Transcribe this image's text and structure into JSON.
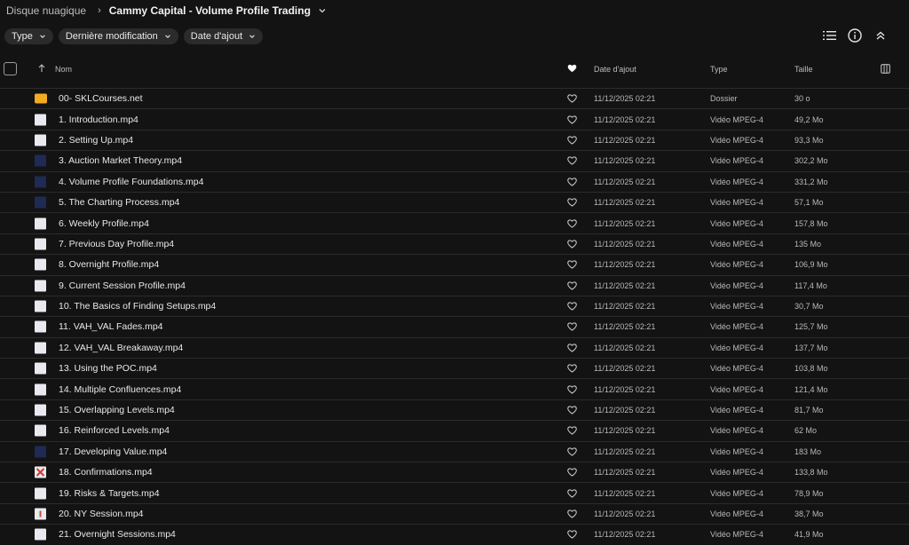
{
  "breadcrumb": {
    "root": "Disque nuagique",
    "current": "Cammy Capital - Volume Profile Trading"
  },
  "filters": [
    {
      "label": "Type"
    },
    {
      "label": "Dernière modification"
    },
    {
      "label": "Date d'ajout"
    }
  ],
  "columns": {
    "name": "Nom",
    "date_added": "Date d'ajout",
    "type": "Type",
    "size": "Taille"
  },
  "rows": [
    {
      "name": "00- SKLCourses.net",
      "date": "11/12/2025 02:21",
      "type": "Dossier",
      "size": "30 o",
      "icon": "folder-icon"
    },
    {
      "name": "1. Introduction.mp4",
      "date": "11/12/2025 02:21",
      "type": "Vidéo MPEG-4",
      "size": "49,2 Mo",
      "icon": "video-thumbnail-icon"
    },
    {
      "name": "2. Setting Up.mp4",
      "date": "11/12/2025 02:21",
      "type": "Vidéo MPEG-4",
      "size": "93,3 Mo",
      "icon": "video-thumbnail-icon"
    },
    {
      "name": "3. Auction Market Theory.mp4",
      "date": "11/12/2025 02:21",
      "type": "Vidéo MPEG-4",
      "size": "302,2 Mo",
      "icon": "video-thumbnail-icon"
    },
    {
      "name": "4. Volume Profile Foundations.mp4",
      "date": "11/12/2025 02:21",
      "type": "Vidéo MPEG-4",
      "size": "331,2 Mo",
      "icon": "video-thumbnail-icon"
    },
    {
      "name": "5. The Charting Process.mp4",
      "date": "11/12/2025 02:21",
      "type": "Vidéo MPEG-4",
      "size": "57,1 Mo",
      "icon": "video-thumbnail-icon"
    },
    {
      "name": "6. Weekly Profile.mp4",
      "date": "11/12/2025 02:21",
      "type": "Vidéo MPEG-4",
      "size": "157,8 Mo",
      "icon": "video-thumbnail-icon"
    },
    {
      "name": "7. Previous Day Profile.mp4",
      "date": "11/12/2025 02:21",
      "type": "Vidéo MPEG-4",
      "size": "135 Mo",
      "icon": "video-thumbnail-icon"
    },
    {
      "name": "8. Overnight Profile.mp4",
      "date": "11/12/2025 02:21",
      "type": "Vidéo MPEG-4",
      "size": "106,9 Mo",
      "icon": "video-thumbnail-icon"
    },
    {
      "name": "9. Current Session Profile.mp4",
      "date": "11/12/2025 02:21",
      "type": "Vidéo MPEG-4",
      "size": "117,4 Mo",
      "icon": "video-thumbnail-icon"
    },
    {
      "name": "10. The Basics of Finding Setups.mp4",
      "date": "11/12/2025 02:21",
      "type": "Vidéo MPEG-4",
      "size": "30,7 Mo",
      "icon": "video-thumbnail-icon"
    },
    {
      "name": "11. VAH_VAL Fades.mp4",
      "date": "11/12/2025 02:21",
      "type": "Vidéo MPEG-4",
      "size": "125,7 Mo",
      "icon": "video-thumbnail-icon"
    },
    {
      "name": "12. VAH_VAL Breakaway.mp4",
      "date": "11/12/2025 02:21",
      "type": "Vidéo MPEG-4",
      "size": "137,7 Mo",
      "icon": "video-thumbnail-icon"
    },
    {
      "name": "13. Using the POC.mp4",
      "date": "11/12/2025 02:21",
      "type": "Vidéo MPEG-4",
      "size": "103,8 Mo",
      "icon": "video-thumbnail-icon"
    },
    {
      "name": "14. Multiple Confluences.mp4",
      "date": "11/12/2025 02:21",
      "type": "Vidéo MPEG-4",
      "size": "121,4 Mo",
      "icon": "video-thumbnail-icon"
    },
    {
      "name": "15. Overlapping Levels.mp4",
      "date": "11/12/2025 02:21",
      "type": "Vidéo MPEG-4",
      "size": "81,7 Mo",
      "icon": "video-thumbnail-icon"
    },
    {
      "name": "16. Reinforced Levels.mp4",
      "date": "11/12/2025 02:21",
      "type": "Vidéo MPEG-4",
      "size": "62 Mo",
      "icon": "video-thumbnail-icon"
    },
    {
      "name": "17. Developing Value.mp4",
      "date": "11/12/2025 02:21",
      "type": "Vidéo MPEG-4",
      "size": "183 Mo",
      "icon": "video-thumbnail-icon"
    },
    {
      "name": "18. Confirmations.mp4",
      "date": "11/12/2025 02:21",
      "type": "Vidéo MPEG-4",
      "size": "133,8 Mo",
      "icon": "video-thumbnail-icon"
    },
    {
      "name": "19. Risks & Targets.mp4",
      "date": "11/12/2025 02:21",
      "type": "Vidéo MPEG-4",
      "size": "78,9 Mo",
      "icon": "video-thumbnail-icon"
    },
    {
      "name": "20. NY Session.mp4",
      "date": "11/12/2025 02:21",
      "type": "Vidéo MPEG-4",
      "size": "38,7 Mo",
      "icon": "video-thumbnail-icon"
    },
    {
      "name": "21. Overnight Sessions.mp4",
      "date": "11/12/2025 02:21",
      "type": "Vidéo MPEG-4",
      "size": "41,9 Mo",
      "icon": "video-thumbnail-icon"
    }
  ],
  "colors": {
    "background": "#131313",
    "chip": "#2b2b2b",
    "folder": "#f2aa1f"
  }
}
